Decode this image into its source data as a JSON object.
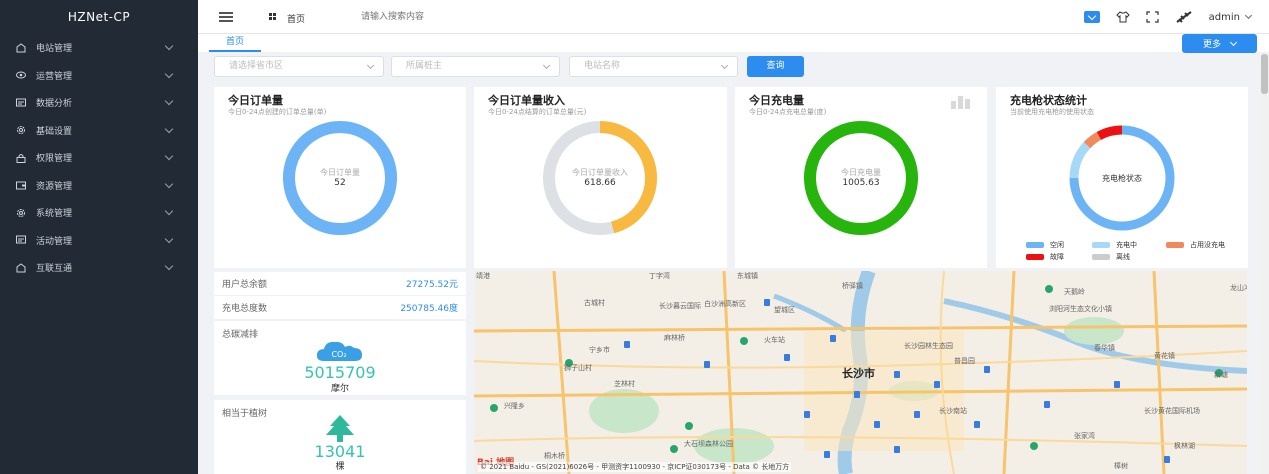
{
  "app": {
    "title": "HZNet-CP"
  },
  "sidebar": {
    "items": [
      {
        "label": "电站管理",
        "icon": "station-icon"
      },
      {
        "label": "运营管理",
        "icon": "eye-icon"
      },
      {
        "label": "数据分析",
        "icon": "message-icon"
      },
      {
        "label": "基础设置",
        "icon": "gear-icon"
      },
      {
        "label": "权限管理",
        "icon": "lock-icon"
      },
      {
        "label": "资源管理",
        "icon": "wallet-icon"
      },
      {
        "label": "系统管理",
        "icon": "gear-icon"
      },
      {
        "label": "活动管理",
        "icon": "message-icon"
      },
      {
        "label": "互联互通",
        "icon": "station-icon"
      }
    ]
  },
  "header": {
    "home_label": "首页",
    "search_placeholder": "请输入搜索内容",
    "user_name": "admin"
  },
  "tabs": {
    "home": "首页",
    "more": "更多"
  },
  "filters": {
    "region_placeholder": "请选择省市区",
    "owner_placeholder": "所属桩主",
    "station_placeholder": "电站名称",
    "query_label": "查询"
  },
  "cards": {
    "orders": {
      "title": "今日订单量",
      "subtitle": "今日0-24点创建的订单总量(单)",
      "ring_label": "今日订单量",
      "value": "52",
      "color": "#6cb4f5",
      "fill": 1.0
    },
    "income": {
      "title": "今日订单量收入",
      "subtitle": "今日0-24点结算的订单总量(元)",
      "ring_label": "今日订单量收入",
      "value": "618.66",
      "color": "#f8b940",
      "fill": 0.46
    },
    "charge": {
      "title": "今日充电量",
      "subtitle": "今日0-24点充电总量(度)",
      "ring_label": "今日充电量",
      "value": "1005.63",
      "color": "#27b40c",
      "fill": 1.0
    },
    "gun_status": {
      "title": "充电枪状态统计",
      "subtitle": "当前使用充电枪的使用状态",
      "center_label": "充电枪状态",
      "segments": [
        {
          "name": "空闲",
          "value": 0.75,
          "color": "#6cb4f5"
        },
        {
          "name": "充电中",
          "value": 0.12,
          "color": "#a6d8f7"
        },
        {
          "name": "占用没充电",
          "value": 0.05,
          "color": "#f08a5d"
        },
        {
          "name": "故障",
          "value": 0.08,
          "color": "#ee1111"
        },
        {
          "name": "离线",
          "value": 0.0,
          "color": "#cccccc"
        }
      ]
    }
  },
  "stats": {
    "balance_label": "用户总余额",
    "balance_value": "27275.52元",
    "charge_total_label": "充电总度数",
    "charge_total_value": "250785.46度",
    "carbon_title": "总碳减排",
    "carbon_icon_text": "CO₂",
    "carbon_value": "5015709",
    "carbon_unit": "摩尔",
    "tree_title": "相当于植树",
    "tree_value": "13041",
    "tree_unit": "棵"
  },
  "map": {
    "city": "长沙市",
    "labels": [
      "丁字湾",
      "靖港",
      "桥驿镇",
      "龙山冲",
      "东城镇",
      "白沙洲高新区",
      "古城村",
      "长沙暮云国际",
      "宁乡市",
      "狮子山村",
      "麻林桥",
      "火车站",
      "长沙园林生态园",
      "长沙黄花国际机场",
      "长沙南站",
      "大石坝森林公园",
      "望城区",
      "新塘",
      "芝林村",
      "兴隆乡",
      "普昌园",
      "桐木桥",
      "张家湾",
      "樟树",
      "枫林湖",
      "天鹅岭",
      "浏阳河生态文化小镇",
      "春华镇",
      "黄花镇"
    ],
    "copyright": "© 2021 Baidu - GS(2021)6026号 - 甲测资字1100930 - 京ICP证030173号 - Data © 长地万方",
    "logo_text": "Bai 地图"
  }
}
